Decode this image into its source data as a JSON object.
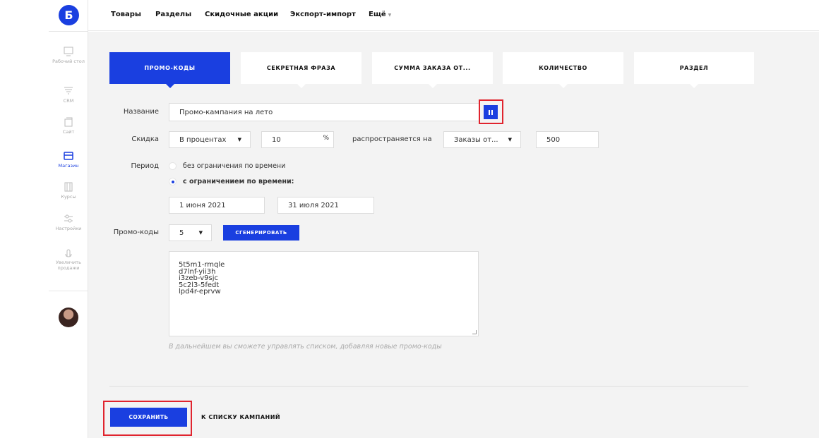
{
  "logo": {
    "letter": "Б"
  },
  "sidebar": {
    "items": [
      {
        "label": "Рабочий стол",
        "icon": "monitor-icon"
      },
      {
        "label": "CRM",
        "icon": "funnel-icon"
      },
      {
        "label": "Сайт",
        "icon": "site-icon"
      },
      {
        "label": "Магазин",
        "icon": "shop-icon",
        "active": true
      },
      {
        "label": "Курсы",
        "icon": "courses-icon"
      },
      {
        "label": "Настройки",
        "icon": "settings-icon"
      },
      {
        "label": "Увеличить продажи",
        "icon": "hand-icon"
      }
    ]
  },
  "topnav": {
    "items": [
      "Товары",
      "Разделы",
      "Скидочные акции",
      "Экспорт-импорт"
    ],
    "more": "Ещё"
  },
  "tabs": [
    "ПРОМО-КОДЫ",
    "СЕКРЕТНАЯ ФРАЗА",
    "СУММА ЗАКАЗА ОТ...",
    "КОЛИЧЕСТВО",
    "РАЗДЕЛ"
  ],
  "form": {
    "name_label": "Название",
    "name_value": "Промо-кампания на лето",
    "discount_label": "Скидка",
    "discount_type": "В процентах",
    "discount_value": "10",
    "percent_sign": "%",
    "applies_label": "распространяется на",
    "applies_value": "Заказы от...",
    "amount_value": "500",
    "period_label": "Период",
    "period_option_1": "без ограничения по времени",
    "period_option_2": "с ограничением по времени:",
    "date_from": "1 июня 2021",
    "date_to": "31 июля 2021",
    "codes_label": "Промо-коды",
    "codes_count": "5",
    "generate_label": "СГЕНЕРИРОВАТЬ",
    "codes": [
      "5t5m1-rmqle",
      "d7lnf-yii3h",
      "i3zeb-v9sjc",
      "5c2l3-5fedt",
      "lpd4r-eprvw"
    ],
    "hint": "В дальнейшем вы сможете управлять списком, добавляя новые промо-коды"
  },
  "footer": {
    "save_label": "СОХРАНИТЬ",
    "back_label": "К СПИСКУ КАМПАНИЙ"
  },
  "colors": {
    "accent": "#1a3fe0",
    "highlight": "#e0242e",
    "background": "#f3f3f3"
  }
}
